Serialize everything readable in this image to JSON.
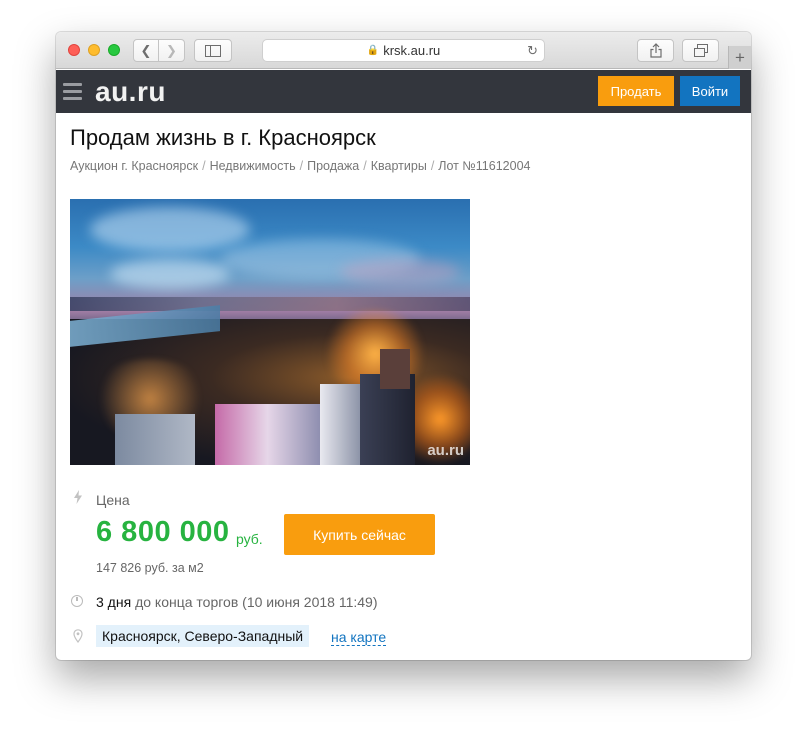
{
  "browser": {
    "url": "krsk.au.ru",
    "new_tab_symbol": "+"
  },
  "site": {
    "logo": "au.ru",
    "sell_label": "Продать",
    "login_label": "Войти"
  },
  "listing": {
    "title": "Продам жизнь в г. Красноярск",
    "breadcrumb": [
      "Аукцион г. Красноярск",
      "Недвижимость",
      "Продажа",
      "Квартиры",
      "Лот №11612004"
    ],
    "breadcrumb_separator": "/",
    "photo_watermark": "au.ru",
    "price_label": "Цена",
    "price_value": "6 800 000",
    "price_currency": "руб.",
    "buy_label": "Купить сейчас",
    "price_per_m2": "147 826 руб. за м2",
    "time_left_value": "3 дня",
    "time_left_text": "до конца торгов",
    "end_date": "(10 июня 2018 11:49)",
    "location": "Красноярск, Северо-Западный",
    "map_link": "на карте"
  },
  "colors": {
    "header_bg": "#33363d",
    "sell_button": "#f99d0e",
    "login_button": "#1274c0",
    "price_green": "#27b340",
    "link_blue": "#1274c0",
    "location_bg": "#e3f1fb"
  }
}
